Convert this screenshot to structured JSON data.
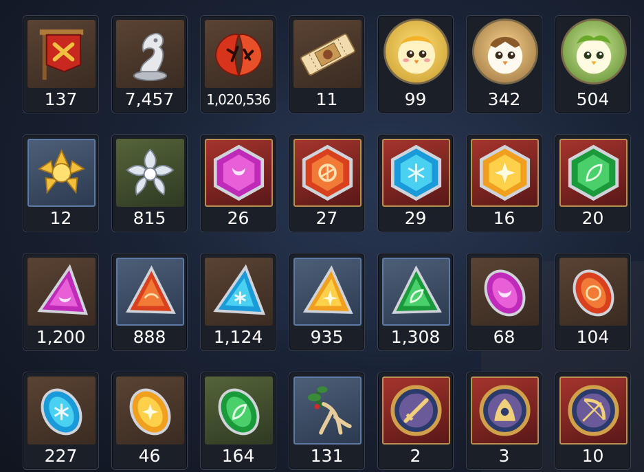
{
  "inventory": {
    "rows": [
      [
        {
          "icon": "war-banner-icon",
          "count": "137"
        },
        {
          "icon": "chess-knight-trophy-icon",
          "count": "7,457"
        },
        {
          "icon": "red-leaf-rune-icon",
          "count": "1,020,536"
        },
        {
          "icon": "ticket-icon",
          "count": "11"
        },
        {
          "icon": "yellow-chick-avatar-icon",
          "count": "99"
        },
        {
          "icon": "brown-chick-avatar-icon",
          "count": "342"
        },
        {
          "icon": "green-chick-avatar-icon",
          "count": "504"
        }
      ],
      [
        {
          "icon": "gold-flower-icon",
          "count": "12"
        },
        {
          "icon": "silver-flower-icon",
          "count": "815"
        },
        {
          "icon": "purple-hexagon-gem-icon",
          "count": "26"
        },
        {
          "icon": "red-hexagon-gem-icon",
          "count": "27"
        },
        {
          "icon": "cyan-hexagon-gem-icon",
          "count": "29"
        },
        {
          "icon": "yellow-hexagon-gem-icon",
          "count": "16"
        },
        {
          "icon": "green-hexagon-gem-icon",
          "count": "20"
        }
      ],
      [
        {
          "icon": "purple-triangle-shard-icon",
          "count": "1,200"
        },
        {
          "icon": "red-triangle-shard-icon",
          "count": "888"
        },
        {
          "icon": "cyan-triangle-shard-icon",
          "count": "1,124"
        },
        {
          "icon": "yellow-triangle-shard-icon",
          "count": "935"
        },
        {
          "icon": "green-triangle-shard-icon",
          "count": "1,308"
        },
        {
          "icon": "purple-oval-stone-icon",
          "count": "68"
        },
        {
          "icon": "red-oval-stone-icon",
          "count": "104"
        }
      ],
      [
        {
          "icon": "cyan-oval-stone-icon",
          "count": "227"
        },
        {
          "icon": "yellow-oval-stone-icon",
          "count": "46"
        },
        {
          "icon": "green-oval-stone-icon",
          "count": "164"
        },
        {
          "icon": "ginseng-root-icon",
          "count": "131"
        },
        {
          "icon": "sword-emblem-icon",
          "count": "2"
        },
        {
          "icon": "mage-emblem-icon",
          "count": "3"
        },
        {
          "icon": "bow-emblem-icon",
          "count": "10"
        }
      ]
    ]
  }
}
